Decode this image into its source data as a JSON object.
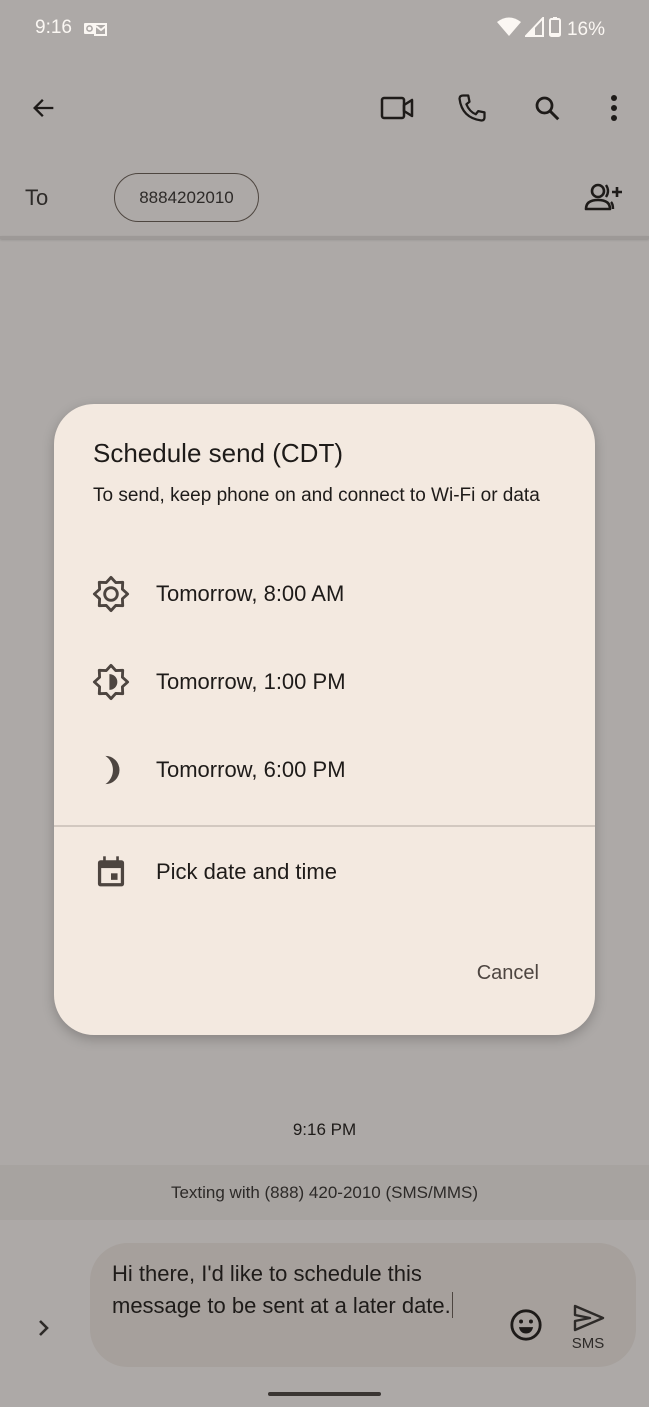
{
  "status_bar": {
    "time": "9:16",
    "notification_icon": "outlook-icon",
    "wifi_icon": "wifi-icon",
    "signal_icon": "cellular-signal-icon",
    "battery_icon": "battery-icon",
    "battery_percent": "16%"
  },
  "toolbar": {
    "back_icon": "arrow-back-icon",
    "actions": [
      "video-call-icon",
      "phone-icon",
      "search-icon",
      "more-vert-icon"
    ]
  },
  "recipient": {
    "to_label": "To",
    "chip": "8884202010",
    "add_contact_icon": "add-person-icon"
  },
  "dialog": {
    "title": "Schedule send (CDT)",
    "subtitle": "To send, keep phone on and connect to Wi-Fi or data",
    "options": [
      {
        "icon": "brightness-high-icon",
        "label": "Tomorrow, 8:00 AM"
      },
      {
        "icon": "brightness-medium-icon",
        "label": "Tomorrow, 1:00 PM"
      },
      {
        "icon": "moon-icon",
        "label": "Tomorrow, 6:00 PM"
      }
    ],
    "custom_option": {
      "icon": "calendar-icon",
      "label": "Pick date and time"
    },
    "cancel_label": "Cancel"
  },
  "conversation": {
    "timestamp": "9:16 PM",
    "texting_with": "Texting with (888) 420-2010 (SMS/MMS)"
  },
  "composer": {
    "text": "Hi there, I'd like to schedule this message to be sent at a later date.",
    "send_label": "SMS"
  },
  "colors": {
    "scrim_background": "#ada9a7",
    "dialog_background": "#f3e9e0",
    "text_primary": "#1e1b19",
    "status_text": "#fbf7f3"
  }
}
